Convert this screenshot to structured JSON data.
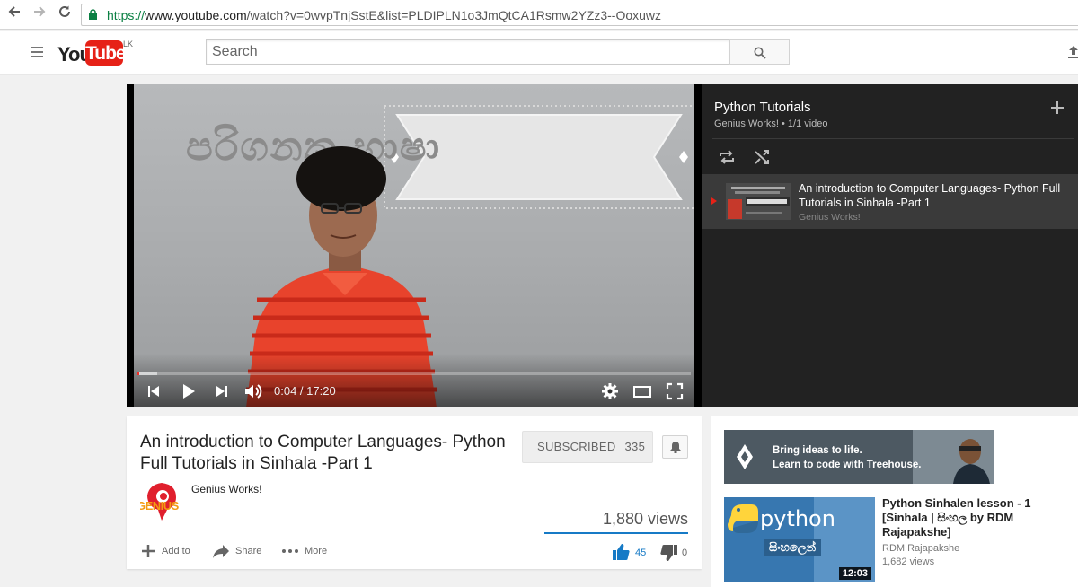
{
  "browser": {
    "url_scheme": "https://",
    "url_host": "www.youtube.com",
    "url_path": "/watch?v=0wvpTnjSstE&list=PLDIPLN1o3JmQtCA1Rsmw2YZz3--Ooxuwz"
  },
  "masthead": {
    "logo_you": "You",
    "logo_tube": "Tube",
    "country": "LK",
    "search_placeholder": "Search"
  },
  "player": {
    "banner_text": "පරිගනක භාෂා",
    "time": "0:04 / 17:20",
    "progress_fraction": 0.004,
    "loaded_fraction": 0.035
  },
  "playlist": {
    "title": "Python Tutorials",
    "subtitle": "Genius Works! • 1/1 video",
    "items": [
      {
        "title": "An introduction to Computer Languages- Python Full Tutorials in Sinhala -Part 1",
        "channel": "Genius Works!"
      }
    ]
  },
  "video": {
    "title": "An introduction to Computer Languages- Python Full Tutorials in Sinhala -Part 1",
    "channel": "Genius Works!",
    "avatar_text": "GENIUS",
    "subscribe_label": "SUBSCRIBED",
    "subscriber_count": "335",
    "views": "1,880 views",
    "likes": "45",
    "dislikes": "0",
    "like_fraction": 1.0,
    "actions": {
      "add_to": "Add to",
      "share": "Share",
      "more": "More"
    }
  },
  "sidebar": {
    "ad_line1": "Bring ideas to life.",
    "ad_line2": "Learn to code with Treehouse.",
    "recommended": [
      {
        "title": "Python Sinhalen lesson - 1 [Sinhala | සිංහල by RDM Rajapakshe]",
        "channel": "RDM Rajapakshe",
        "views": "1,682 views",
        "duration": "12:03",
        "thumb_word": "python",
        "thumb_sinhala": "සිංහලෙන්"
      }
    ]
  },
  "colors": {
    "youtube_red": "#e62117",
    "link_blue": "#167ac6",
    "playlist_bg": "#222222"
  }
}
